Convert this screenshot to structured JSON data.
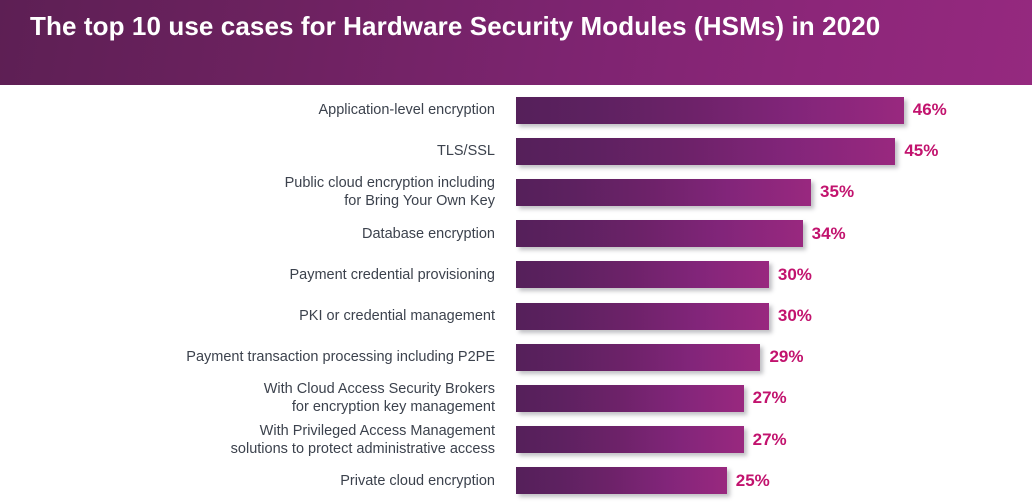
{
  "header": {
    "title": "The top 10 use cases for Hardware Security Modules (HSMs) in 2020",
    "gradient_start": "#5d1f54",
    "gradient_end": "#95297f"
  },
  "colors": {
    "bar_gradient_start": "#55205a",
    "bar_gradient_end": "#99287f",
    "value_label": "#c2136e",
    "category_label": "#3c424d",
    "background": "#ffffff"
  },
  "chart_data": {
    "type": "bar",
    "orientation": "horizontal",
    "title": "The top 10 use cases for Hardware Security Modules (HSMs) in 2020",
    "xlabel": "",
    "ylabel": "",
    "xlim": [
      0,
      50
    ],
    "grid": false,
    "legend": "none",
    "categories": [
      "Application-level encryption",
      "TLS/SSL",
      "Public cloud encryption including for Bring Your Own Key",
      "Database encryption",
      "Payment credential provisioning",
      "PKI or credential management",
      "Payment transaction processing including P2PE",
      "With Cloud Access Security Brokers for encryption key management",
      "With Privileged Access Management solutions to protect administrative access",
      "Private cloud encryption"
    ],
    "values": [
      46,
      45,
      35,
      34,
      30,
      30,
      29,
      27,
      27,
      25
    ],
    "value_labels": [
      "46%",
      "45%",
      "35%",
      "34%",
      "30%",
      "30%",
      "29%",
      "27%",
      "27%",
      "25%"
    ]
  },
  "rows": [
    {
      "label": "Application-level encryption",
      "value": 46,
      "value_label": "46%"
    },
    {
      "label": "TLS/SSL",
      "value": 45,
      "value_label": "45%"
    },
    {
      "label": "Public cloud encryption including\nfor Bring Your Own Key",
      "value": 35,
      "value_label": "35%"
    },
    {
      "label": "Database encryption",
      "value": 34,
      "value_label": "34%"
    },
    {
      "label": "Payment credential provisioning",
      "value": 30,
      "value_label": "30%"
    },
    {
      "label": "PKI or credential management",
      "value": 30,
      "value_label": "30%"
    },
    {
      "label": "Payment transaction processing including P2PE",
      "value": 29,
      "value_label": "29%"
    },
    {
      "label": "With Cloud Access Security Brokers\nfor encryption key management",
      "value": 27,
      "value_label": "27%"
    },
    {
      "label": "With Privileged Access Management\nsolutions to protect administrative access",
      "value": 27,
      "value_label": "27%"
    },
    {
      "label": "Private cloud encryption",
      "value": 25,
      "value_label": "25%"
    }
  ]
}
